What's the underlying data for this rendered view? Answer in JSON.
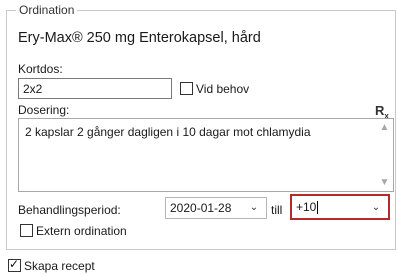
{
  "ordination": {
    "legend": "Ordination",
    "drug_name": "Ery-Max® 250 mg Enterokapsel, hård",
    "kortdos_label": "Kortdos:",
    "kortdos_value": "2x2",
    "vid_behov_label": "Vid behov",
    "vid_behov_checked": false,
    "dosering_label": "Dosering:",
    "rx_symbol": "R",
    "rx_sub": "x",
    "dosering_text": "2 kapslar 2 gånger dagligen i 10 dagar mot chlamydia",
    "behandlingsperiod_label": "Behandlingsperiod:",
    "start_date": "2020-01-28",
    "till_label": "till",
    "end_value": "+10",
    "extern_label": "Extern ordination",
    "extern_checked": false
  },
  "footer": {
    "skapa_recept_label": "Skapa recept",
    "skapa_recept_checked": true
  },
  "colors": {
    "focus_border": "#b22a2a",
    "group_border": "#c9c9c9"
  },
  "icons": {
    "dropdown": "chevron-down-icon",
    "scroll_up": "scroll-up-icon",
    "scroll_down": "scroll-down-icon",
    "check": "check-icon"
  }
}
